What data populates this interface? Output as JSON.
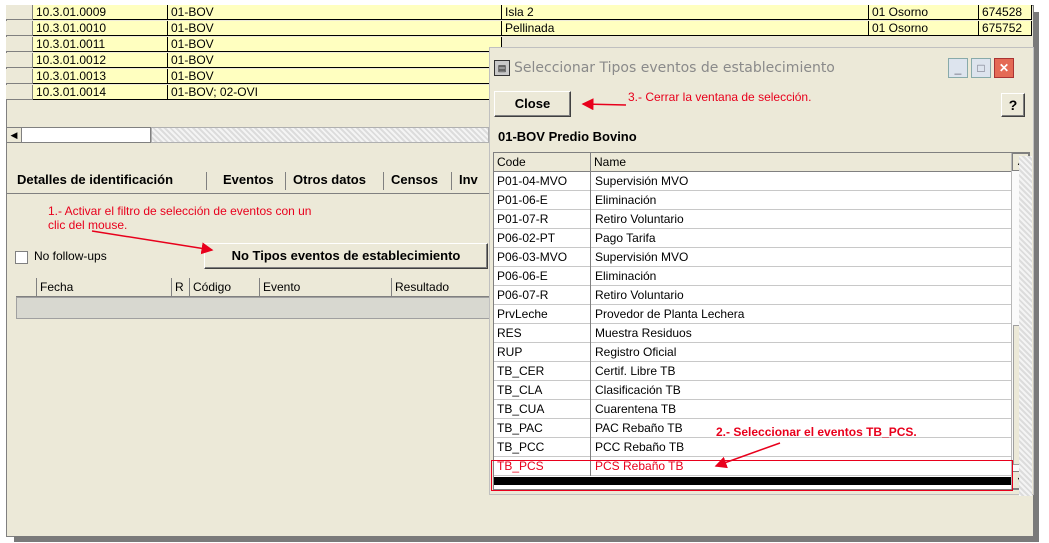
{
  "grid": {
    "rows": [
      {
        "code": "10.3.01.0009",
        "type": "01-BOV",
        "name": "Isla 2",
        "region": "01 Osorno",
        "num": "674528"
      },
      {
        "code": "10.3.01.0010",
        "type": "01-BOV",
        "name": "Pellinada",
        "region": "01 Osorno",
        "num": "675752"
      },
      {
        "code": "10.3.01.0011",
        "type": "01-BOV",
        "name": "",
        "region": "",
        "num": ""
      },
      {
        "code": "10.3.01.0012",
        "type": "01-BOV",
        "name": "",
        "region": "",
        "num": ""
      },
      {
        "code": "10.3.01.0013",
        "type": "01-BOV",
        "name": "",
        "region": "",
        "num": ""
      },
      {
        "code": "10.3.01.0014",
        "type": "01-BOV; 02-OVI",
        "name": "",
        "region": "",
        "num": ""
      }
    ]
  },
  "tabs": [
    "Detalles de identificación",
    "Eventos",
    "Otros datos",
    "Censos",
    "Inv"
  ],
  "annotations": {
    "step1_line1": "1.- Activar el filtro de selección de eventos con un",
    "step1_line2": "clic del mouse.",
    "step2": "2.- Seleccionar el eventos TB_PCS.",
    "step3": "3.- Cerrar la ventana de selección."
  },
  "filter_button": "No Tipos eventos de establecimiento",
  "no_followups": "No follow-ups",
  "events_table": {
    "columns": [
      "Fecha",
      "R",
      "Código",
      "Evento",
      "Resultado"
    ]
  },
  "dialog": {
    "title": "Seleccionar Tipos eventos de establecimiento",
    "close_label": "Close",
    "help_icon": "?",
    "subtitle": "01-BOV Predio Bovino",
    "columns": [
      "Code",
      "Name"
    ],
    "items": [
      {
        "code": "P01-04-MVO",
        "name": "Supervisión MVO"
      },
      {
        "code": "P01-06-E",
        "name": "Eliminación"
      },
      {
        "code": "P01-07-R",
        "name": "Retiro Voluntario"
      },
      {
        "code": "P06-02-PT",
        "name": "Pago Tarifa"
      },
      {
        "code": "P06-03-MVO",
        "name": "Supervisión MVO"
      },
      {
        "code": "P06-06-E",
        "name": "Eliminación"
      },
      {
        "code": "P06-07-R",
        "name": "Retiro Voluntario"
      },
      {
        "code": "PrvLeche",
        "name": "Provedor de Planta Lechera"
      },
      {
        "code": "RES",
        "name": "Muestra Residuos"
      },
      {
        "code": "RUP",
        "name": "Registro Oficial"
      },
      {
        "code": "TB_CER",
        "name": "Certif. Libre TB"
      },
      {
        "code": "TB_CLA",
        "name": "Clasificación TB"
      },
      {
        "code": "TB_CUA",
        "name": "Cuarentena TB"
      },
      {
        "code": "TB_PAC",
        "name": "PAC Rebaño TB"
      },
      {
        "code": "TB_PCC",
        "name": "PCC Rebaño TB"
      },
      {
        "code": "TB_PCS",
        "name": "PCS Rebaño TB"
      }
    ],
    "selected_code": "TB_PCS"
  },
  "colors": {
    "grid_bg": "#ffffc0",
    "annotation": "#e8001c",
    "window_bg": "#ece9d8"
  }
}
